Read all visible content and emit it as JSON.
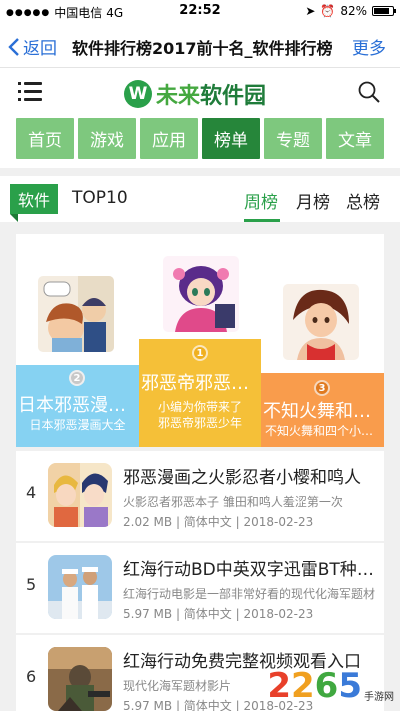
{
  "status_bar": {
    "carrier": "中国电信",
    "network": "4G",
    "time": "22:52",
    "battery": "82%",
    "battery_level": 0.82
  },
  "nav": {
    "back_label": "返回",
    "title": "软件排行榜2017前十名_软件排行榜",
    "more_label": "更多"
  },
  "header": {
    "logo_mark": "W",
    "logo_part1": "未来",
    "logo_part2": "软件园"
  },
  "tabs": [
    {
      "label": "首页",
      "active": false
    },
    {
      "label": "游戏",
      "active": false
    },
    {
      "label": "应用",
      "active": false
    },
    {
      "label": "榜单",
      "active": true
    },
    {
      "label": "专题",
      "active": false
    },
    {
      "label": "文章",
      "active": false
    }
  ],
  "section": {
    "label": "软件",
    "title": "TOP10",
    "periods": [
      {
        "label": "周榜",
        "active": true
      },
      {
        "label": "月榜",
        "active": false
      },
      {
        "label": "总榜",
        "active": false
      }
    ]
  },
  "podium": [
    {
      "rank": "1",
      "name": "邪恶帝邪恶少年",
      "desc1": "小编为你带来了",
      "desc2": "邪恶帝邪恶少年",
      "color": "#f5c038"
    },
    {
      "rank": "2",
      "name": "日本邪恶漫画大全",
      "desc1": "日本邪恶漫画大全",
      "desc2": "",
      "color": "#86d2f2"
    },
    {
      "rank": "3",
      "name": "不知火舞和四个小男孩",
      "desc1": "不知火舞和四个小男孩",
      "desc2": "",
      "color": "#f99c4c"
    }
  ],
  "list": [
    {
      "rank": "4",
      "title": "邪恶漫画之火影忍者小樱和鸣人",
      "desc": "火影忍者邪恶本子 雏田和鸣人羞涩第一次",
      "size": "2.02 MB",
      "lang": "简体中文",
      "date": "2018-02-23"
    },
    {
      "rank": "5",
      "title": "红海行动BD中英双字迅雷BT种子下载",
      "desc": "红海行动电影是一部非常好看的现代化海军题材",
      "size": "5.97 MB",
      "lang": "简体中文",
      "date": "2018-02-23"
    },
    {
      "rank": "6",
      "title": "红海行动免费完整视频观看入口",
      "desc": "现代化海军题材影片",
      "size": "5.97 MB",
      "lang": "简体中文",
      "date": "2018-02-23"
    }
  ],
  "watermark": {
    "digits": [
      "2",
      "2",
      "6",
      "5"
    ],
    "sub": "手游网"
  },
  "colors": {
    "accent_green": "#2aa04a",
    "tab_green": "#7ec87e",
    "tab_active": "#26863a",
    "link_blue": "#2a6fd6"
  }
}
